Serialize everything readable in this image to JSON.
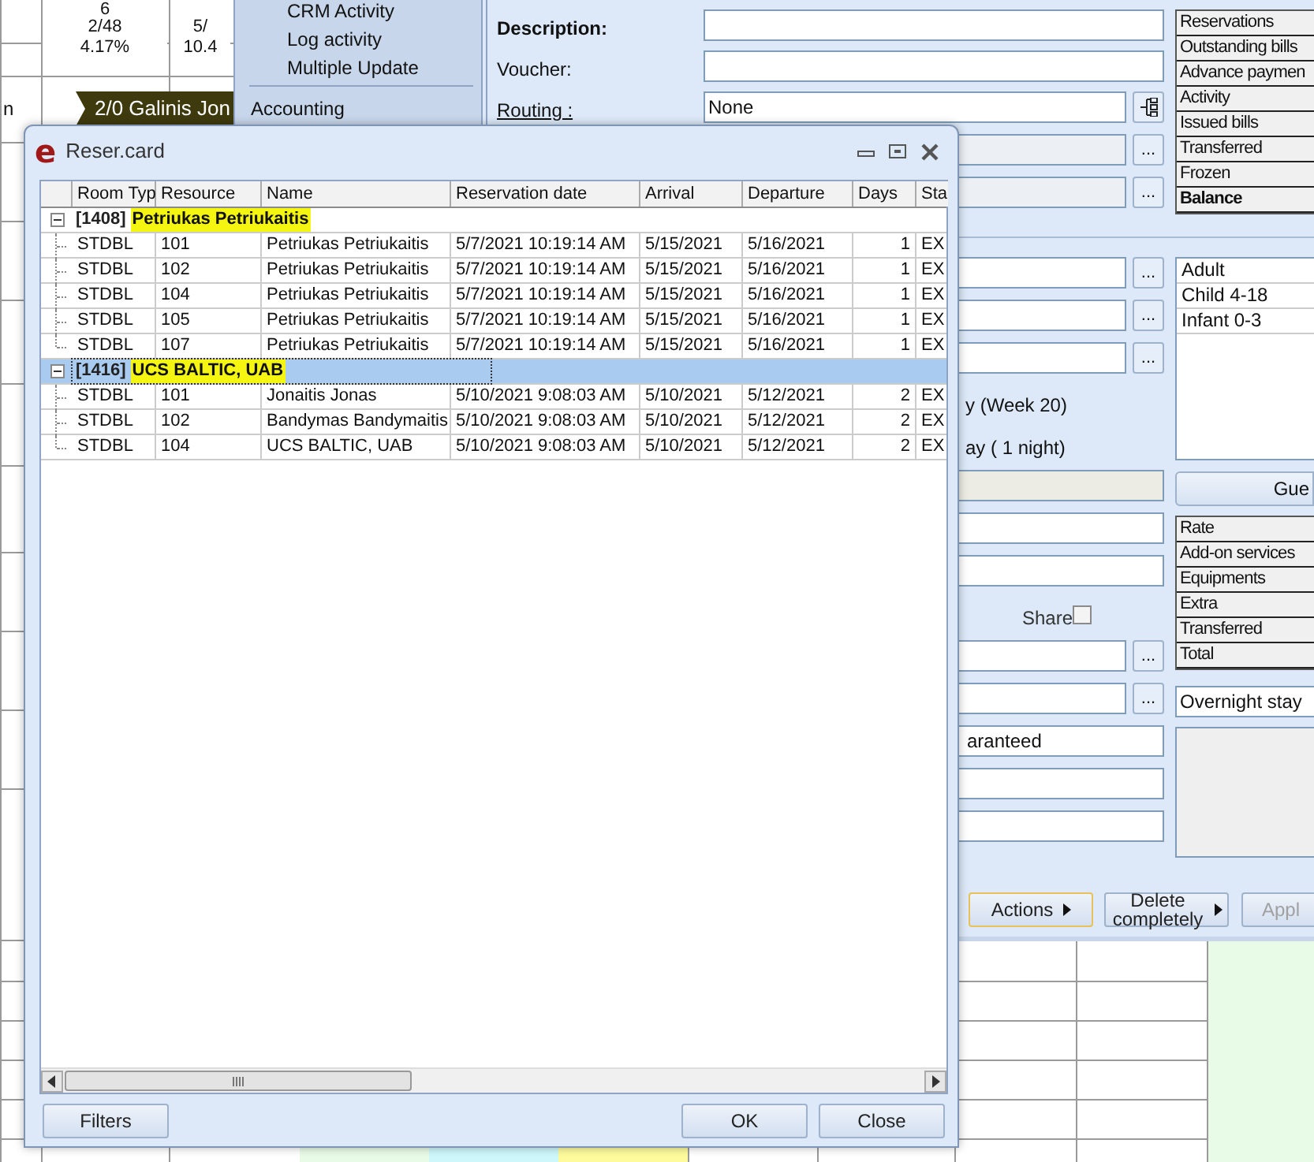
{
  "calendar": {
    "cells": [
      {
        "text": "6"
      },
      {
        "text": "2/48"
      },
      {
        "text": "4.17%"
      },
      {
        "text": "5/"
      },
      {
        "text": "10.4"
      }
    ],
    "row_label": "n",
    "booking": "2/0 Galinis Jon"
  },
  "menu": {
    "items": [
      "CRM Activity",
      "Log activity",
      "Multiple Update",
      "Accounting"
    ]
  },
  "form": {
    "description_label": "Description:",
    "voucher_label": "Voucher:",
    "routing_label": "Routing :",
    "routing_value": "None",
    "period_text": "y (Week 20)",
    "nights_text": "ay ( 1 night)",
    "share_label": "Share",
    "share_checked": false,
    "guarantee_value": "aranteed",
    "stay_type": "Overnight stay",
    "guest_button": "Gue",
    "browse_buttons": [
      "...",
      "...",
      "...",
      "...",
      "...",
      "...",
      "..."
    ],
    "summary_tabs": [
      {
        "label": "Reservations",
        "bold": false
      },
      {
        "label": "Outstanding bills",
        "bold": false
      },
      {
        "label": "Advance paymen",
        "bold": false
      },
      {
        "label": "Activity",
        "bold": false
      },
      {
        "label": "Issued bills",
        "bold": false
      },
      {
        "label": "Transferred",
        "bold": false
      },
      {
        "label": "Frozen",
        "bold": false
      },
      {
        "label": "Balance",
        "bold": true
      }
    ],
    "guest_types": [
      "Adult",
      "Child 4-18",
      "Infant 0-3"
    ],
    "charges": [
      "Rate",
      "Add-on services",
      "Equipments",
      "Extra",
      "Transferred",
      "Total"
    ],
    "buttons": [
      {
        "label": "Actions",
        "focused": true,
        "disabled": false,
        "submenu": true
      },
      {
        "label": "Delete completely",
        "focused": false,
        "disabled": false,
        "submenu": true
      },
      {
        "label": "Appl",
        "focused": false,
        "disabled": true,
        "submenu": false
      }
    ]
  },
  "dialog": {
    "logo": "e",
    "title": "Reser.card",
    "columns": [
      "Room Typ",
      "Resource",
      "Name",
      "Reservation date",
      "Arrival",
      "Departure",
      "Days",
      "Sta"
    ],
    "groups": [
      {
        "id": "[1408]",
        "name": "Petriukas Petriukaitis",
        "expanded": true,
        "selected": false,
        "rows": [
          [
            "STDBL",
            "101",
            "Petriukas Petriukaitis",
            "5/7/2021 10:19:14 AM",
            "5/15/2021",
            "5/16/2021",
            "1",
            "EX"
          ],
          [
            "STDBL",
            "102",
            "Petriukas Petriukaitis",
            "5/7/2021 10:19:14 AM",
            "5/15/2021",
            "5/16/2021",
            "1",
            "EX"
          ],
          [
            "STDBL",
            "104",
            "Petriukas Petriukaitis",
            "5/7/2021 10:19:14 AM",
            "5/15/2021",
            "5/16/2021",
            "1",
            "EX"
          ],
          [
            "STDBL",
            "105",
            "Petriukas Petriukaitis",
            "5/7/2021 10:19:14 AM",
            "5/15/2021",
            "5/16/2021",
            "1",
            "EX"
          ],
          [
            "STDBL",
            "107",
            "Petriukas Petriukaitis",
            "5/7/2021 10:19:14 AM",
            "5/15/2021",
            "5/16/2021",
            "1",
            "EX"
          ]
        ]
      },
      {
        "id": "[1416]",
        "name": "UCS BALTIC, UAB",
        "expanded": true,
        "selected": true,
        "rows": [
          [
            "STDBL",
            "101",
            "Jonaitis Jonas",
            "5/10/2021 9:08:03 AM",
            "5/10/2021",
            "5/12/2021",
            "2",
            "EX"
          ],
          [
            "STDBL",
            "102",
            "Bandymas Bandymaitis",
            "5/10/2021 9:08:03 AM",
            "5/10/2021",
            "5/12/2021",
            "2",
            "EX"
          ],
          [
            "STDBL",
            "104",
            "UCS BALTIC, UAB",
            "5/10/2021 9:08:03 AM",
            "5/10/2021",
            "5/12/2021",
            "2",
            "EX"
          ]
        ]
      }
    ],
    "buttons": [
      "Filters",
      "OK",
      "Close"
    ]
  }
}
